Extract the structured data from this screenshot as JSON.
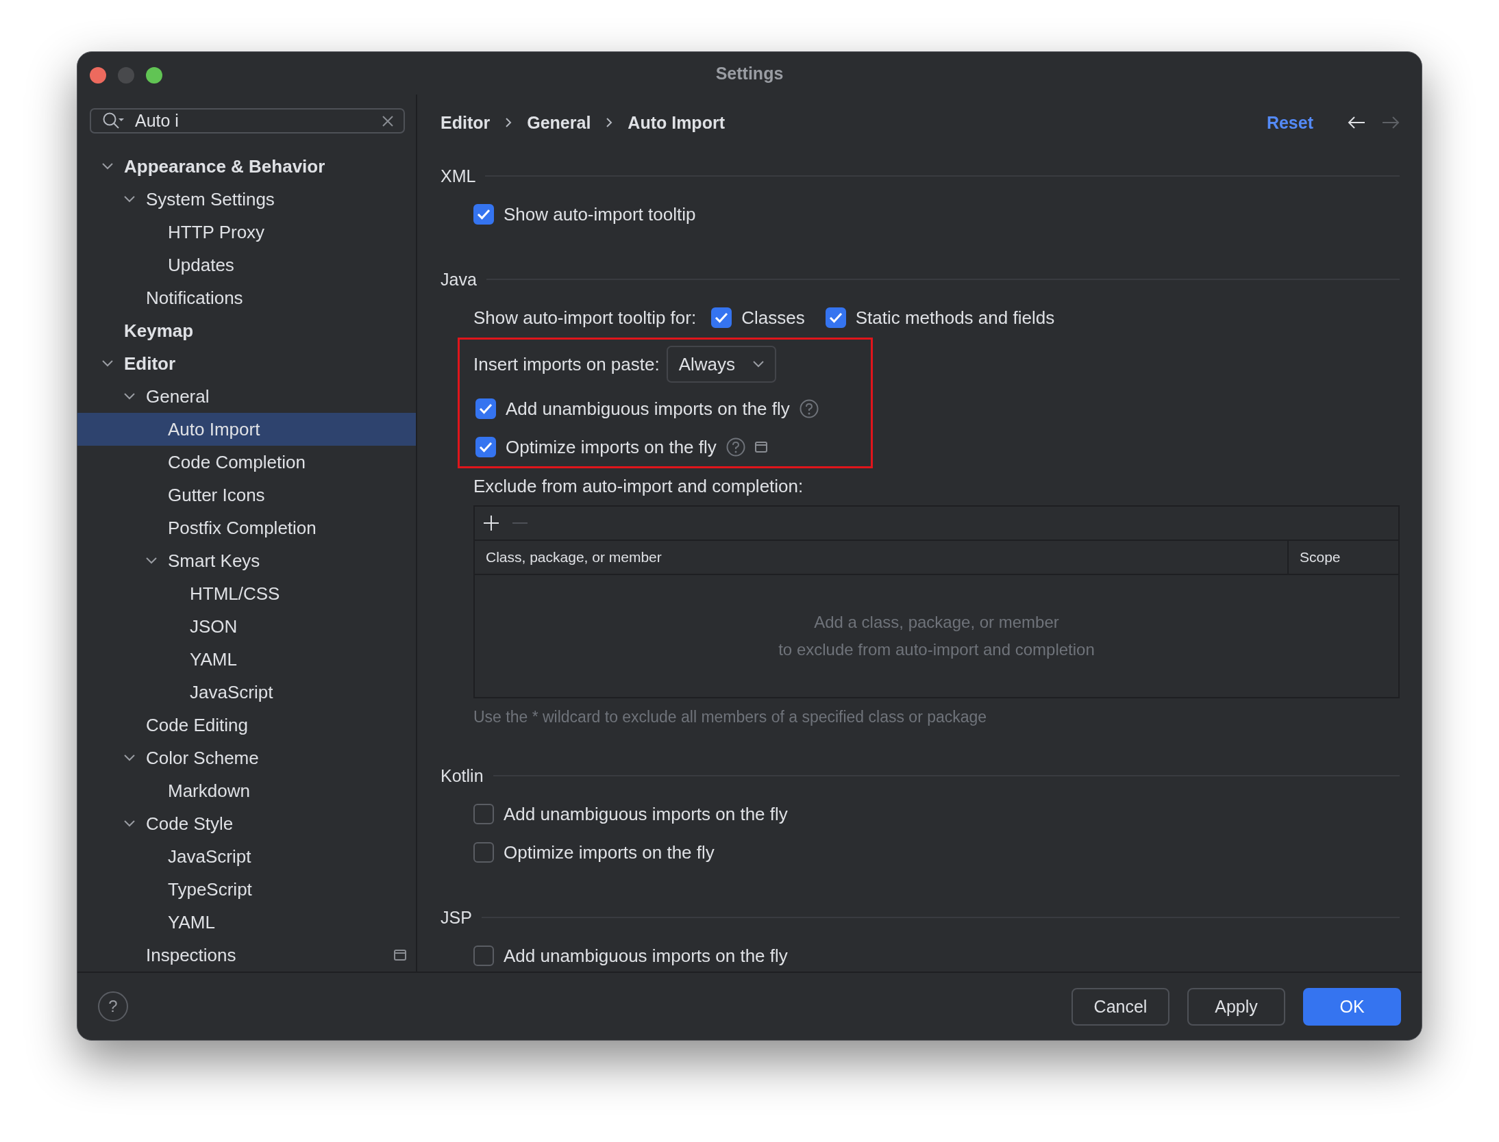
{
  "window": {
    "title": "Settings",
    "traffic_lights": [
      {
        "color": "#ed6a5e"
      },
      {
        "color": "#48494c"
      },
      {
        "color": "#61c454"
      }
    ]
  },
  "search": {
    "value": "Auto i"
  },
  "tree": [
    {
      "label": "Appearance & Behavior",
      "expanded": true,
      "selected": false,
      "children": [
        {
          "label": "System Settings",
          "expanded": true,
          "selected": false,
          "children": [
            {
              "label": "HTTP Proxy",
              "selected": false
            },
            {
              "label": "Updates",
              "selected": false
            }
          ]
        },
        {
          "label": "Notifications",
          "selected": false
        }
      ]
    },
    {
      "label": "Keymap",
      "selected": false
    },
    {
      "label": "Editor",
      "expanded": true,
      "selected": false,
      "children": [
        {
          "label": "General",
          "expanded": true,
          "selected": false,
          "children": [
            {
              "label": "Auto Import",
              "selected": true
            },
            {
              "label": "Code Completion",
              "selected": false
            },
            {
              "label": "Gutter Icons",
              "selected": false
            },
            {
              "label": "Postfix Completion",
              "selected": false
            },
            {
              "label": "Smart Keys",
              "expanded": true,
              "selected": false,
              "children": [
                {
                  "label": "HTML/CSS",
                  "selected": false
                },
                {
                  "label": "JSON",
                  "selected": false
                },
                {
                  "label": "YAML",
                  "selected": false
                },
                {
                  "label": "JavaScript",
                  "selected": false
                }
              ]
            }
          ]
        },
        {
          "label": "Code Editing",
          "selected": false
        },
        {
          "label": "Color Scheme",
          "expanded": true,
          "selected": false,
          "children": [
            {
              "label": "Markdown",
              "selected": false
            }
          ]
        },
        {
          "label": "Code Style",
          "expanded": true,
          "selected": false,
          "children": [
            {
              "label": "JavaScript",
              "selected": false
            },
            {
              "label": "TypeScript",
              "selected": false
            },
            {
              "label": "YAML",
              "selected": false
            }
          ]
        },
        {
          "label": "Inspections",
          "selected": false,
          "badge": true
        }
      ]
    }
  ],
  "breadcrumb": [
    "Editor",
    "General",
    "Auto Import"
  ],
  "reset": "Reset",
  "nav": [
    {
      "kind": "back",
      "disabled": false
    },
    {
      "kind": "forward",
      "disabled": true
    }
  ],
  "sections": [
    {
      "title": "XML",
      "rows": [
        {
          "kind": "checkbox",
          "label": "Show auto-import tooltip",
          "checked": true
        }
      ]
    },
    {
      "title": "Java",
      "rows": [
        {
          "kind": "checkgroup",
          "label": "Show auto-import tooltip for:",
          "options": [
            {
              "label": "Classes",
              "checked": true
            },
            {
              "label": "Static methods and fields",
              "checked": true
            }
          ]
        },
        {
          "kind": "highlight",
          "rows": [
            {
              "kind": "dropdown",
              "label": "Insert imports on paste:",
              "value": "Always"
            },
            {
              "kind": "checkbox",
              "label": "Add unambiguous imports on the fly",
              "checked": true,
              "help": true
            },
            {
              "kind": "checkbox",
              "label": "Optimize imports on the fly",
              "checked": true,
              "help": true,
              "badge": true
            }
          ]
        },
        {
          "kind": "table",
          "label": "Exclude from auto-import and completion:",
          "toolbar": [
            {
              "kind": "add",
              "disabled": false
            },
            {
              "kind": "remove",
              "disabled": true
            }
          ],
          "columns": [
            "Class, package, or member",
            "Scope"
          ],
          "empty_text": "Add a class, package, or member\nto exclude from auto-import and completion",
          "hint": "Use the * wildcard to exclude all members of a specified class or package"
        }
      ]
    },
    {
      "title": "Kotlin",
      "rows": [
        {
          "kind": "checkbox",
          "label": "Add unambiguous imports on the fly",
          "checked": false
        },
        {
          "kind": "checkbox",
          "label": "Optimize imports on the fly",
          "checked": false
        }
      ]
    },
    {
      "title": "JSP",
      "rows": [
        {
          "kind": "checkbox",
          "label": "Add unambiguous imports on the fly",
          "checked": false
        }
      ]
    }
  ],
  "footer": {
    "help": "?",
    "buttons": [
      {
        "label": "Cancel",
        "primary": false
      },
      {
        "label": "Apply",
        "primary": false
      },
      {
        "label": "OK",
        "primary": true
      }
    ]
  }
}
